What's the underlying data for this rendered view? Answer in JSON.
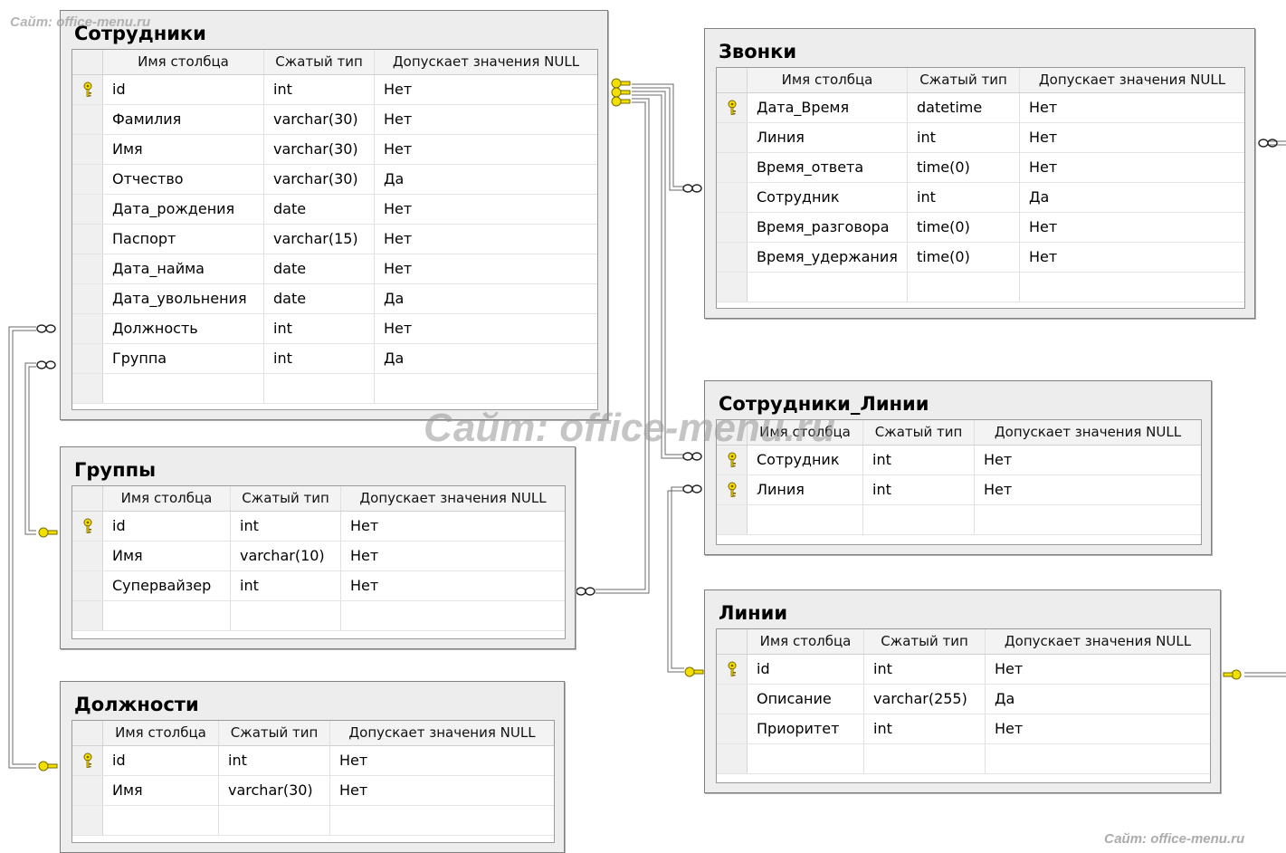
{
  "headers": [
    "Имя столбца",
    "Сжатый тип",
    "Допускает значения NULL"
  ],
  "watermarks": {
    "top_left": "Сайт: office-menu.ru",
    "center": "Сайт: office-menu.ru",
    "bottom_right": "Сайт: office-menu.ru"
  },
  "tables": {
    "sotrudniki": {
      "title": "Сотрудники",
      "rows": [
        {
          "name": "id",
          "type": "int",
          "nullable": "Нет",
          "pk": true
        },
        {
          "name": "Фамилия",
          "type": "varchar(30)",
          "nullable": "Нет"
        },
        {
          "name": "Имя",
          "type": "varchar(30)",
          "nullable": "Нет"
        },
        {
          "name": "Отчество",
          "type": "varchar(30)",
          "nullable": "Да"
        },
        {
          "name": "Дата_рождения",
          "type": "date",
          "nullable": "Нет"
        },
        {
          "name": "Паспорт",
          "type": "varchar(15)",
          "nullable": "Нет"
        },
        {
          "name": "Дата_найма",
          "type": "date",
          "nullable": "Нет"
        },
        {
          "name": "Дата_увольнения",
          "type": "date",
          "nullable": "Да"
        },
        {
          "name": "Должность",
          "type": "int",
          "nullable": "Нет"
        },
        {
          "name": "Группа",
          "type": "int",
          "nullable": "Да"
        }
      ]
    },
    "zvonki": {
      "title": "Звонки",
      "rows": [
        {
          "name": "Дата_Время",
          "type": "datetime",
          "nullable": "Нет",
          "pk": true
        },
        {
          "name": "Линия",
          "type": "int",
          "nullable": "Нет"
        },
        {
          "name": "Время_ответа",
          "type": "time(0)",
          "nullable": "Нет"
        },
        {
          "name": "Сотрудник",
          "type": "int",
          "nullable": "Да"
        },
        {
          "name": "Время_разговора",
          "type": "time(0)",
          "nullable": "Нет"
        },
        {
          "name": "Время_удержания",
          "type": "time(0)",
          "nullable": "Нет"
        }
      ]
    },
    "gruppy": {
      "title": "Группы",
      "rows": [
        {
          "name": "id",
          "type": "int",
          "nullable": "Нет",
          "pk": true
        },
        {
          "name": "Имя",
          "type": "varchar(10)",
          "nullable": "Нет"
        },
        {
          "name": "Супервайзер",
          "type": "int",
          "nullable": "Нет"
        }
      ]
    },
    "sotrudniki_linii": {
      "title": "Сотрудники_Линии",
      "rows": [
        {
          "name": "Сотрудник",
          "type": "int",
          "nullable": "Нет",
          "pk": true
        },
        {
          "name": "Линия",
          "type": "int",
          "nullable": "Нет",
          "pk": true
        }
      ]
    },
    "dolzhnosti": {
      "title": "Должности",
      "rows": [
        {
          "name": "id",
          "type": "int",
          "nullable": "Нет",
          "pk": true
        },
        {
          "name": "Имя",
          "type": "varchar(30)",
          "nullable": "Нет"
        }
      ]
    },
    "linii": {
      "title": "Линии",
      "rows": [
        {
          "name": "id",
          "type": "int",
          "nullable": "Нет",
          "pk": true
        },
        {
          "name": "Описание",
          "type": "varchar(255)",
          "nullable": "Да"
        },
        {
          "name": "Приоритет",
          "type": "int",
          "nullable": "Нет"
        }
      ]
    }
  },
  "relationships": [
    {
      "from": "sotrudniki.Должность",
      "to": "dolzhnosti.id"
    },
    {
      "from": "sotrudniki.Группа",
      "to": "gruppy.id"
    },
    {
      "from": "zvonki.Сотрудник",
      "to": "sotrudniki.id"
    },
    {
      "from": "sotrudniki_linii.Сотрудник",
      "to": "sotrudniki.id"
    },
    {
      "from": "gruppy.Супервайзер",
      "to": "sotrudniki.id"
    },
    {
      "from": "sotrudniki_linii.Линия",
      "to": "linii.id"
    },
    {
      "from": "zvonki.Линия",
      "to": "linii.id"
    }
  ]
}
